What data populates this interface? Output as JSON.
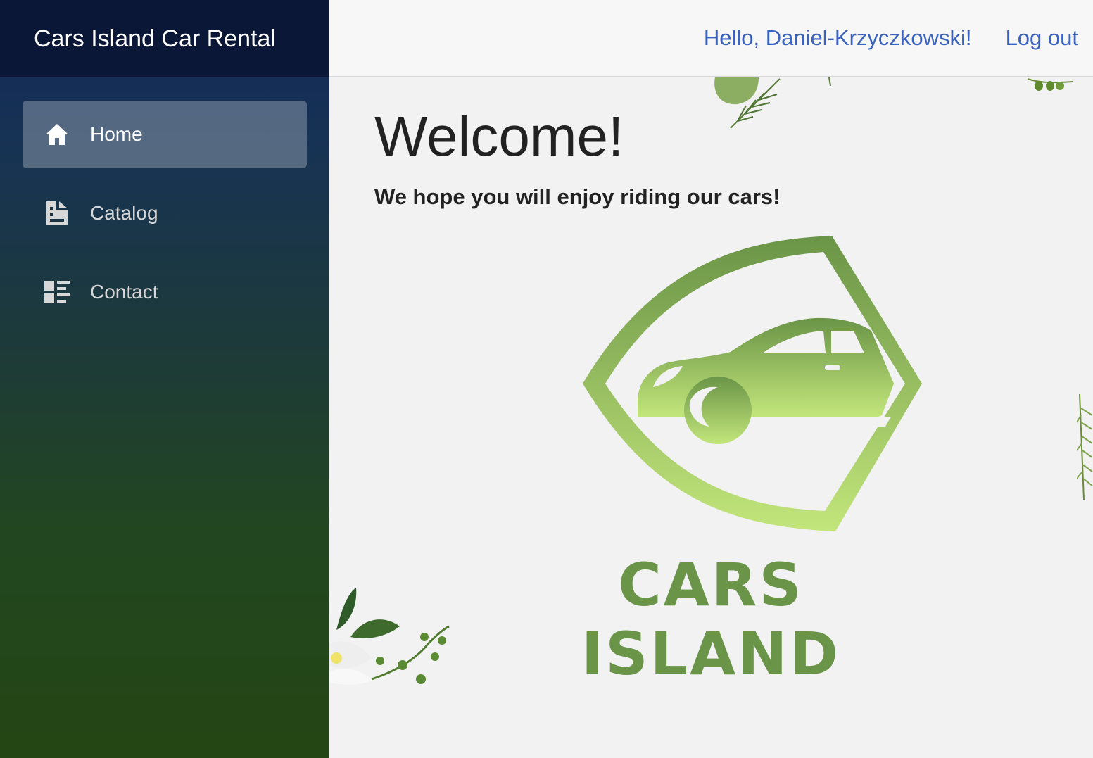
{
  "app": {
    "brand": "Cars Island Car Rental"
  },
  "sidebar": {
    "items": [
      {
        "label": "Home",
        "icon": "home-icon",
        "active": true
      },
      {
        "label": "Catalog",
        "icon": "document-icon",
        "active": false
      },
      {
        "label": "Contact",
        "icon": "list-icon",
        "active": false
      }
    ]
  },
  "header": {
    "greeting": "Hello, Daniel-Krzyczkowski!",
    "logout": "Log out"
  },
  "main": {
    "title": "Welcome!",
    "subtitle": "We hope you will enjoy riding our cars!",
    "logo_text": "CARS ISLAND"
  },
  "colors": {
    "sidebar_top": "#11285a",
    "sidebar_bottom": "#244614",
    "brand_bar": "#0a1736",
    "link": "#3a63c0",
    "logo_green": "#6a9447",
    "logo_light_green": "#c3e67b"
  }
}
